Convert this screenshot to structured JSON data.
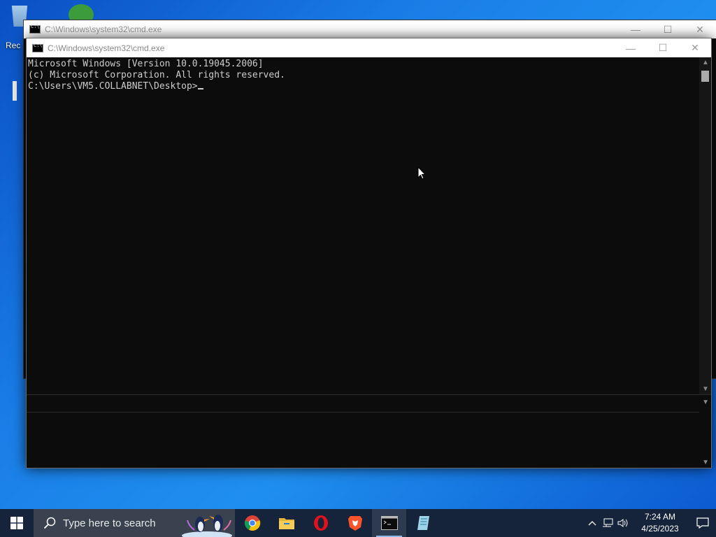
{
  "desktop": {
    "partial_label": "Rec"
  },
  "back_window": {
    "title": "C:\\Windows\\system32\\cmd.exe",
    "minimize_glyph": "—",
    "maximize_glyph": "☐",
    "close_glyph": "✕"
  },
  "front_window": {
    "title": "C:\\Windows\\system32\\cmd.exe",
    "minimize_glyph": "—",
    "maximize_glyph": "☐",
    "close_glyph": "✕",
    "console_lines": [
      "Microsoft Windows [Version 10.0.19045.2006]",
      "(c) Microsoft Corporation. All rights reserved.",
      "",
      "C:\\Users\\VM5.COLLABNET\\Desktop>"
    ]
  },
  "taskbar": {
    "search_placeholder": "Type here to search",
    "apps": [
      {
        "icon": "chrome-icon"
      },
      {
        "icon": "file-explorer-icon"
      },
      {
        "icon": "opera-icon"
      },
      {
        "icon": "brave-icon"
      },
      {
        "icon": "cmd-icon",
        "active": true
      },
      {
        "icon": "notepad-icon"
      }
    ],
    "clock_time": "7:24 AM",
    "clock_date": "4/25/2023"
  },
  "colors": {
    "desktop_blue": "#1a7fe8",
    "taskbar": "#15243a",
    "console_bg": "#0c0c0c",
    "console_text": "#cccccc"
  }
}
